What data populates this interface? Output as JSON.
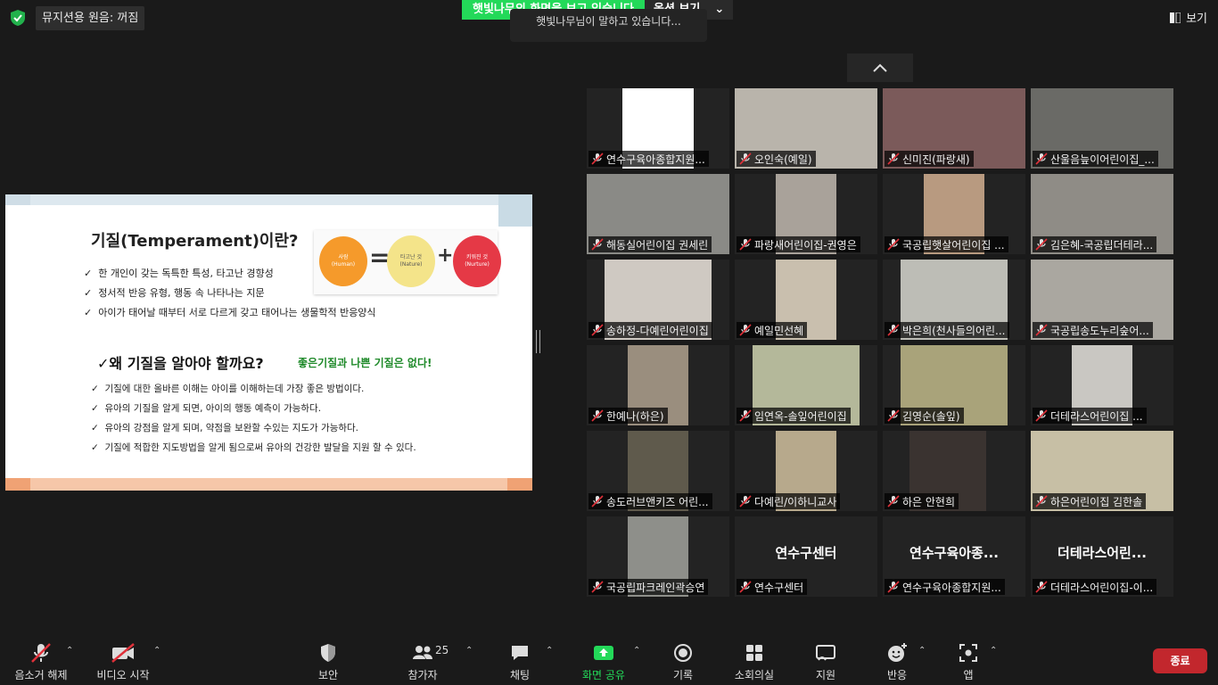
{
  "top": {
    "music_mode": "뮤지션용 원음: 꺼짐",
    "share_banner": "햇빛나무의 화면을 보고 있습니다",
    "share_options": "옵션 보기",
    "tooltip": "햇빛나무님이 말하고 있습니다...",
    "view": "보기"
  },
  "slide": {
    "title": "기질(Temperament)이란?",
    "bullets1": [
      "한 개인이 갖는 독특한 특성, 타고난 경향성",
      "정서적 반응 유형, 행동 속 나타나는 지문",
      "아이가 태어날 때부터 서로 다르게 갖고 태어나는 생물학적 반응양식"
    ],
    "formula": {
      "c1_ko": "사람",
      "c1_en": "(Human)",
      "c2_ko": "타고난 것",
      "c2_en": "(Nature)",
      "c3_ko": "키워진 것",
      "c3_en": "(Nurture)",
      "eq": "=",
      "plus": "+"
    },
    "heading2": "✓왜 기질을 알아야 할까요?",
    "heading2_green": "좋은기질과 나쁜 기질은 없다!",
    "bullets2": [
      "기질에 대한 올바른 이해는 아이를 이해하는데 가장 좋은 방법이다.",
      "유아의 기질을 알게 되면,  아이의 행동 예측이 가능하다.",
      " 유아의 강점을 알게 되며, 약점을 보완할 수있는 지도가 가능하다.",
      "기질에 적합한 지도방법을 알게 됨으로써 유아의 건강한 발달을 지원 할 수 있다."
    ]
  },
  "participants": [
    {
      "name": "연수구육아종합지원...",
      "bg": "#ffffff"
    },
    {
      "name": "오인숙(예일)",
      "bg": "#b9b4ab"
    },
    {
      "name": "신미진(파랑새)",
      "bg": "#7b5a5a"
    },
    {
      "name": "산울음늪이어린이집_...",
      "bg": "#6a6a66"
    },
    {
      "name": "해동실어린이집 권세린",
      "bg": "#8a8a86"
    },
    {
      "name": "파랑새어린이집-권영은",
      "bg": "#a9a29a"
    },
    {
      "name": "국공립햇살어린이집 ...",
      "bg": "#b89a80"
    },
    {
      "name": "김은혜-국공립더테라...",
      "bg": "#8f8c86"
    },
    {
      "name": "송하정-다예린어린이집",
      "bg": "#cfc9c2"
    },
    {
      "name": "예일민선혜",
      "bg": "#c9bfae"
    },
    {
      "name": "박은희(천사들의어린...",
      "bg": "#bdbdb6"
    },
    {
      "name": "국공립송도누리숲어...",
      "bg": "#aaa7a0"
    },
    {
      "name": "한예나(하은)",
      "bg": "#9a8e7e"
    },
    {
      "name": "임연옥-솔잎어린이집",
      "bg": "#b4b89a"
    },
    {
      "name": "김영순(솔잎)",
      "bg": "#a9a37a"
    },
    {
      "name": "더테라스어린이집   ...",
      "bg": "#c9c7c2"
    },
    {
      "name": "송도러브앤키즈 어린...",
      "bg": "#5f5a4c"
    },
    {
      "name": "다예린/이하니교사",
      "bg": "#b7a98c"
    },
    {
      "name": "하은 안현희",
      "bg": "#3a3330"
    },
    {
      "name": "하은어린이집 김한솔",
      "bg": "#c7bfa5"
    },
    {
      "name": "국공립파크레인곽승연",
      "bg": "#8e8f8a"
    },
    {
      "name": "연수구센터",
      "big": "연수구센터"
    },
    {
      "name": "연수구육아종합지원...",
      "big": "연수구육아종..."
    },
    {
      "name": "더테라스어린이집-이...",
      "big": "더테라스어린..."
    }
  ],
  "toolbar": {
    "mute": "음소거 해제",
    "video": "비디오 시작",
    "security": "보안",
    "participants": "참가자",
    "participants_count": "25",
    "chat": "채팅",
    "share": "화면 공유",
    "record": "기록",
    "breakout": "소회의실",
    "support": "지원",
    "reactions": "반응",
    "apps": "앱",
    "end": "종료"
  }
}
